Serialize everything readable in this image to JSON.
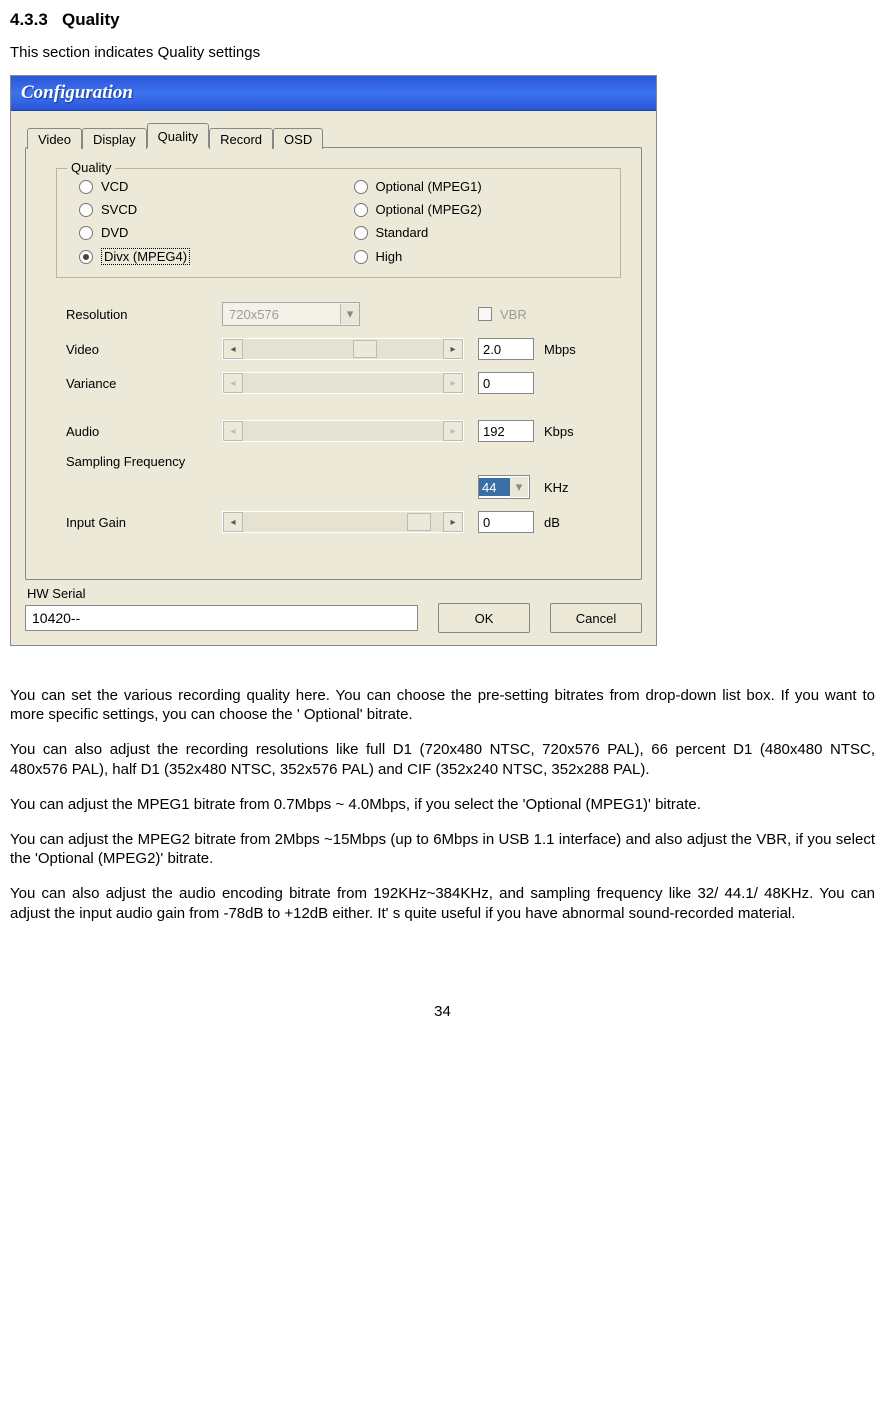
{
  "heading_no": "4.3.3",
  "heading_text": "Quality",
  "intro": "This section indicates Quality settings",
  "dialog": {
    "title": "Configuration",
    "tabs": [
      "Video",
      "Display",
      "Quality",
      "Record",
      "OSD"
    ],
    "active_tab": "Quality",
    "group_label": "Quality",
    "radios_left": [
      "VCD",
      "SVCD",
      "DVD",
      "Divx (MPEG4)"
    ],
    "radios_right": [
      "Optional (MPEG1)",
      "Optional (MPEG2)",
      "Standard",
      "High"
    ],
    "selected_radio": "Divx (MPEG4)",
    "rows": {
      "resolution_label": "Resolution",
      "resolution_value": "720x576",
      "vbr_label": "VBR",
      "video_label": "Video",
      "video_value": "2.0",
      "video_unit": "Mbps",
      "variance_label": "Variance",
      "variance_value": "0",
      "audio_label": "Audio",
      "audio_value": "192",
      "audio_unit": "Kbps",
      "sampling_label": "Sampling Frequency",
      "sampling_value": "44",
      "sampling_unit": "KHz",
      "gain_label": "Input Gain",
      "gain_value": "0",
      "gain_unit": "dB"
    },
    "hw_label": "HW Serial",
    "hw_value": "10420--",
    "ok": "OK",
    "cancel": "Cancel"
  },
  "paragraphs": [
    "You can set the various recording quality here. You can choose the pre-setting bitrates from drop-down list box. If you want to more specific settings, you can choose the ' Optional' bitrate.",
    "You can also adjust the recording resolutions like full D1 (720x480 NTSC, 720x576 PAL), 66 percent D1 (480x480 NTSC, 480x576 PAL), half D1 (352x480 NTSC, 352x576 PAL) and CIF (352x240 NTSC, 352x288 PAL).",
    "You can adjust the MPEG1 bitrate from 0.7Mbps ~ 4.0Mbps, if you select the 'Optional (MPEG1)' bitrate.",
    "You can adjust the MPEG2 bitrate from 2Mbps ~15Mbps (up to 6Mbps in  USB 1.1 interface) and also adjust the VBR, if you select the 'Optional (MPEG2)' bitrate.",
    "You can also adjust the audio encoding bitrate from 192KHz~384KHz, and sampling frequency like 32/ 44.1/ 48KHz. You can adjust the input audio gain from -78dB to +12dB either. It' s quite useful if you have abnormal sound-recorded material."
  ],
  "page_number": "34"
}
